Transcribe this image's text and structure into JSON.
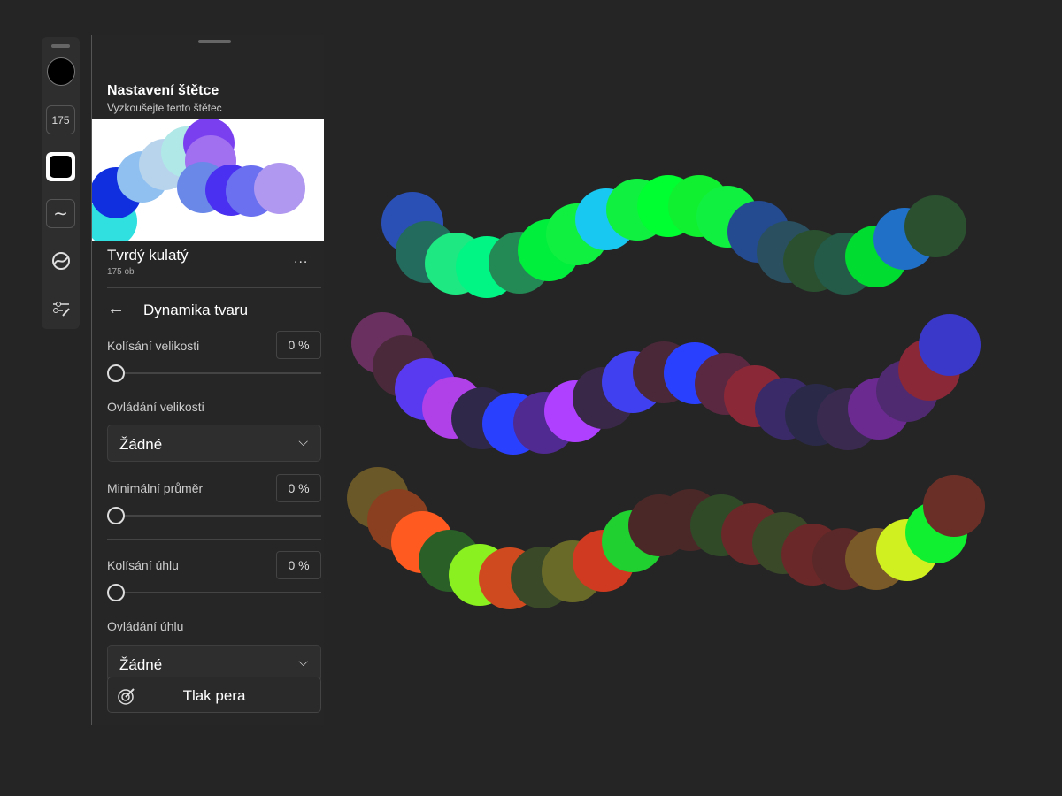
{
  "toolbar": {
    "size_label": "175",
    "items": [
      "color",
      "size",
      "brush-shape",
      "smoothing",
      "brush-mode",
      "brush-settings"
    ]
  },
  "panel": {
    "title": "Nastavení štětce",
    "subtitle": "Vyzkoušejte tento štětec",
    "brush_name": "Tvrdý kulatý",
    "brush_size": "175 ob",
    "more_label": "...",
    "section": "Dynamika tvaru",
    "size_jitter": {
      "label": "Kolísání velikosti",
      "value": "0 %",
      "level": 0
    },
    "size_control": {
      "label": "Ovládání velikosti",
      "selected": "Žádné"
    },
    "min_diameter": {
      "label": "Minimální průměr",
      "value": "0 %",
      "level": 0
    },
    "angle_jitter": {
      "label": "Kolísání úhlu",
      "value": "0 %",
      "level": 0
    },
    "angle_control": {
      "label": "Ovládání úhlu",
      "selected": "Žádné"
    },
    "pen_pressure_label": "Tlak pera"
  },
  "colors": {
    "background": "#252525",
    "preview": [
      "#30e0e0",
      "#1030e0",
      "#90c0f0",
      "#b8d4ec",
      "#b0e8e8",
      "#7a40f0",
      "#a070f0",
      "#6a88e8",
      "#4a30f0",
      "#6a70f0",
      "#b098f0"
    ],
    "stroke1": [
      "#2a4fb5",
      "#236b5c",
      "#1ee882",
      "#00f584",
      "#238a55",
      "#00ee3c",
      "#10f040",
      "#18c8f0",
      "#10f040",
      "#00ff30",
      "#10f030",
      "#10f040",
      "#244a90",
      "#2a5060",
      "#2a5030",
      "#235a48",
      "#00dd30",
      "#2070c8",
      "#2a5030"
    ],
    "stroke2": [
      "#6a3060",
      "#4a2a3a",
      "#5a3af0",
      "#b040e8",
      "#302848",
      "#2a40ff",
      "#502a90",
      "#b040ff",
      "#3a2848",
      "#4040f0",
      "#4a2838",
      "#2a40ff",
      "#5a2840",
      "#8a2838",
      "#3a2a68",
      "#2a2a48",
      "#3a2a50",
      "#6a2a90",
      "#502a70",
      "#8a2838",
      "#3a38c8"
    ],
    "stroke3": [
      "#6a5828",
      "#8a4020",
      "#ff5a20",
      "#2a6028",
      "#8af020",
      "#d04a20",
      "#3a4a28",
      "#6a6a28",
      "#d03a20",
      "#20d030",
      "#4a2828",
      "#4a2828",
      "#304a28",
      "#6a2828",
      "#3a4a28",
      "#6a2828",
      "#5a2828",
      "#7a5a28",
      "#d0f020",
      "#10f030",
      "#6a3028"
    ]
  }
}
